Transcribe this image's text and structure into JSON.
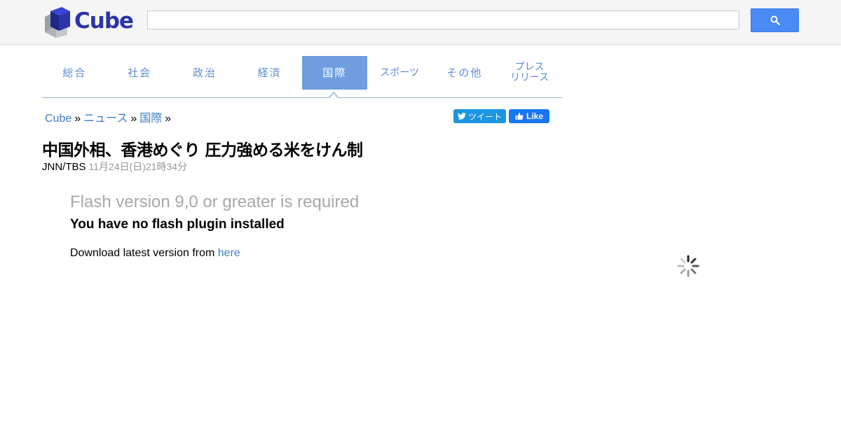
{
  "header": {
    "logo_text": "Cube",
    "search": {
      "value": "",
      "placeholder": ""
    },
    "search_icon": "search-icon"
  },
  "nav": {
    "items": [
      {
        "label": "総合",
        "active": false
      },
      {
        "label": "社会",
        "active": false
      },
      {
        "label": "政治",
        "active": false
      },
      {
        "label": "経済",
        "active": false
      },
      {
        "label": "国際",
        "active": true
      },
      {
        "label": "スポーツ",
        "active": false
      },
      {
        "label": "その他",
        "active": false
      },
      {
        "label_line1": "プレス",
        "label_line2": "リリース",
        "active": false
      }
    ],
    "active_color": "#6f9de0",
    "link_color": "#5b8dd0"
  },
  "breadcrumb": {
    "items": [
      "Cube",
      "ニュース",
      "国際"
    ],
    "separator": "»"
  },
  "social": {
    "tweet_label": "ツイート",
    "like_label": "Like"
  },
  "article": {
    "title": "中国外相、香港めぐり 圧力強める米をけん制",
    "source": "JNN/TBS",
    "date": "11月24日(日)21時34分"
  },
  "flash": {
    "title": "Flash version 9,0 or greater is required",
    "message": "You have no flash plugin installed",
    "download_prefix": "Download latest version from",
    "download_link": "here"
  },
  "colors": {
    "accent": "#4a8af4",
    "link": "#3d7cc9",
    "header_bg": "#f5f5f5"
  }
}
